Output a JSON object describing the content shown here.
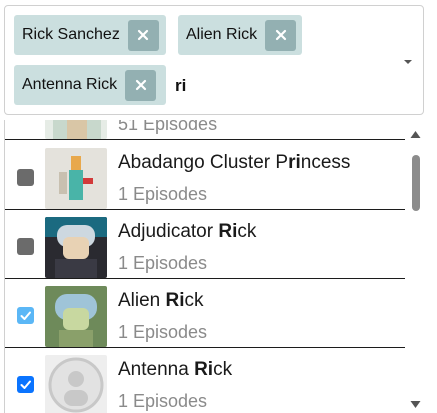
{
  "select": {
    "selected_chips": [
      {
        "label": "Rick Sanchez"
      },
      {
        "label": "Alien Rick"
      },
      {
        "label": "Antenna Rick"
      }
    ],
    "search_value": "ri"
  },
  "menu": {
    "options": [
      {
        "name_pre": "",
        "name_match": "",
        "name_post": "",
        "episodes": "51 Episodes",
        "checked": false
      },
      {
        "name_pre": "Abadango Cluster P",
        "name_match": "ri",
        "name_post": "ncess",
        "episodes": "1 Episodes",
        "checked": false
      },
      {
        "name_pre": "Adjudicator ",
        "name_match": "Ri",
        "name_post": "ck",
        "episodes": "1 Episodes",
        "checked": false
      },
      {
        "name_pre": "Alien ",
        "name_match": "Ri",
        "name_post": "ck",
        "episodes": "1 Episodes",
        "checked": true
      },
      {
        "name_pre": "Antenna ",
        "name_match": "Ri",
        "name_post": "ck",
        "episodes": "1 Episodes",
        "checked": true
      }
    ]
  },
  "colors": {
    "chip_bg": "#cbdfdf",
    "chip_remove_bg": "#93b0b2",
    "checkbox_checked": "#0a74ff",
    "checkbox_unchecked": "#6b6b6b",
    "episode_text": "#8a8a8a"
  },
  "icons": {
    "chip_remove": "close-icon",
    "dropdown": "chevron-down-icon",
    "scroll_up": "arrow-up-icon",
    "scroll_down": "arrow-down-icon",
    "checkbox": "checkmark-icon"
  }
}
